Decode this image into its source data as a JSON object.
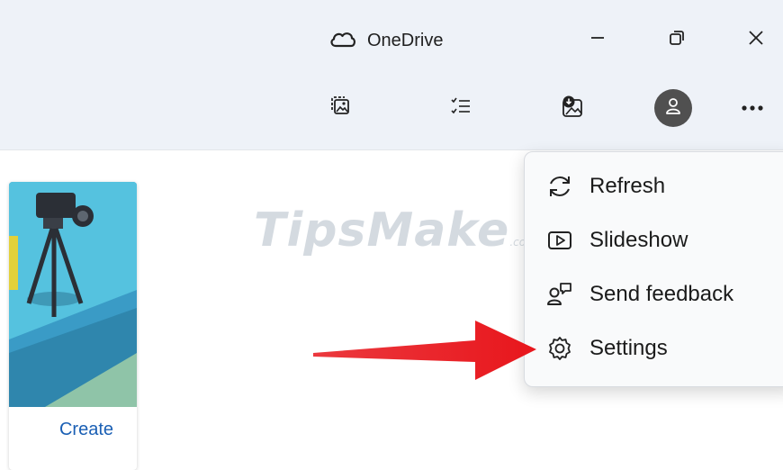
{
  "window": {
    "title": "OneDrive",
    "controls": {
      "minimize_icon": "minimize-icon",
      "restore_icon": "restore-icon",
      "close_icon": "close-icon"
    }
  },
  "toolbar": {
    "icons": [
      "photo-gallery-icon",
      "select-list-icon",
      "download-image-icon",
      "account-icon",
      "more-options-icon"
    ]
  },
  "card": {
    "image_icon": "video-camera-tripod-image",
    "action_label": "Create"
  },
  "watermark": {
    "text": "TipsMake",
    "suffix": ".com"
  },
  "menu": {
    "items": [
      {
        "label": "Refresh",
        "icon": "refresh-icon"
      },
      {
        "label": "Slideshow",
        "icon": "slideshow-icon"
      },
      {
        "label": "Send feedback",
        "icon": "feedback-icon"
      },
      {
        "label": "Settings",
        "icon": "settings-icon"
      }
    ]
  },
  "annotation": {
    "arrow_color": "#e8161c",
    "points_to": "Settings"
  },
  "colors": {
    "titlebar_bg": "#eef2f8",
    "accent_link": "#1a5fb4",
    "menu_bg": "#f9fafb"
  }
}
